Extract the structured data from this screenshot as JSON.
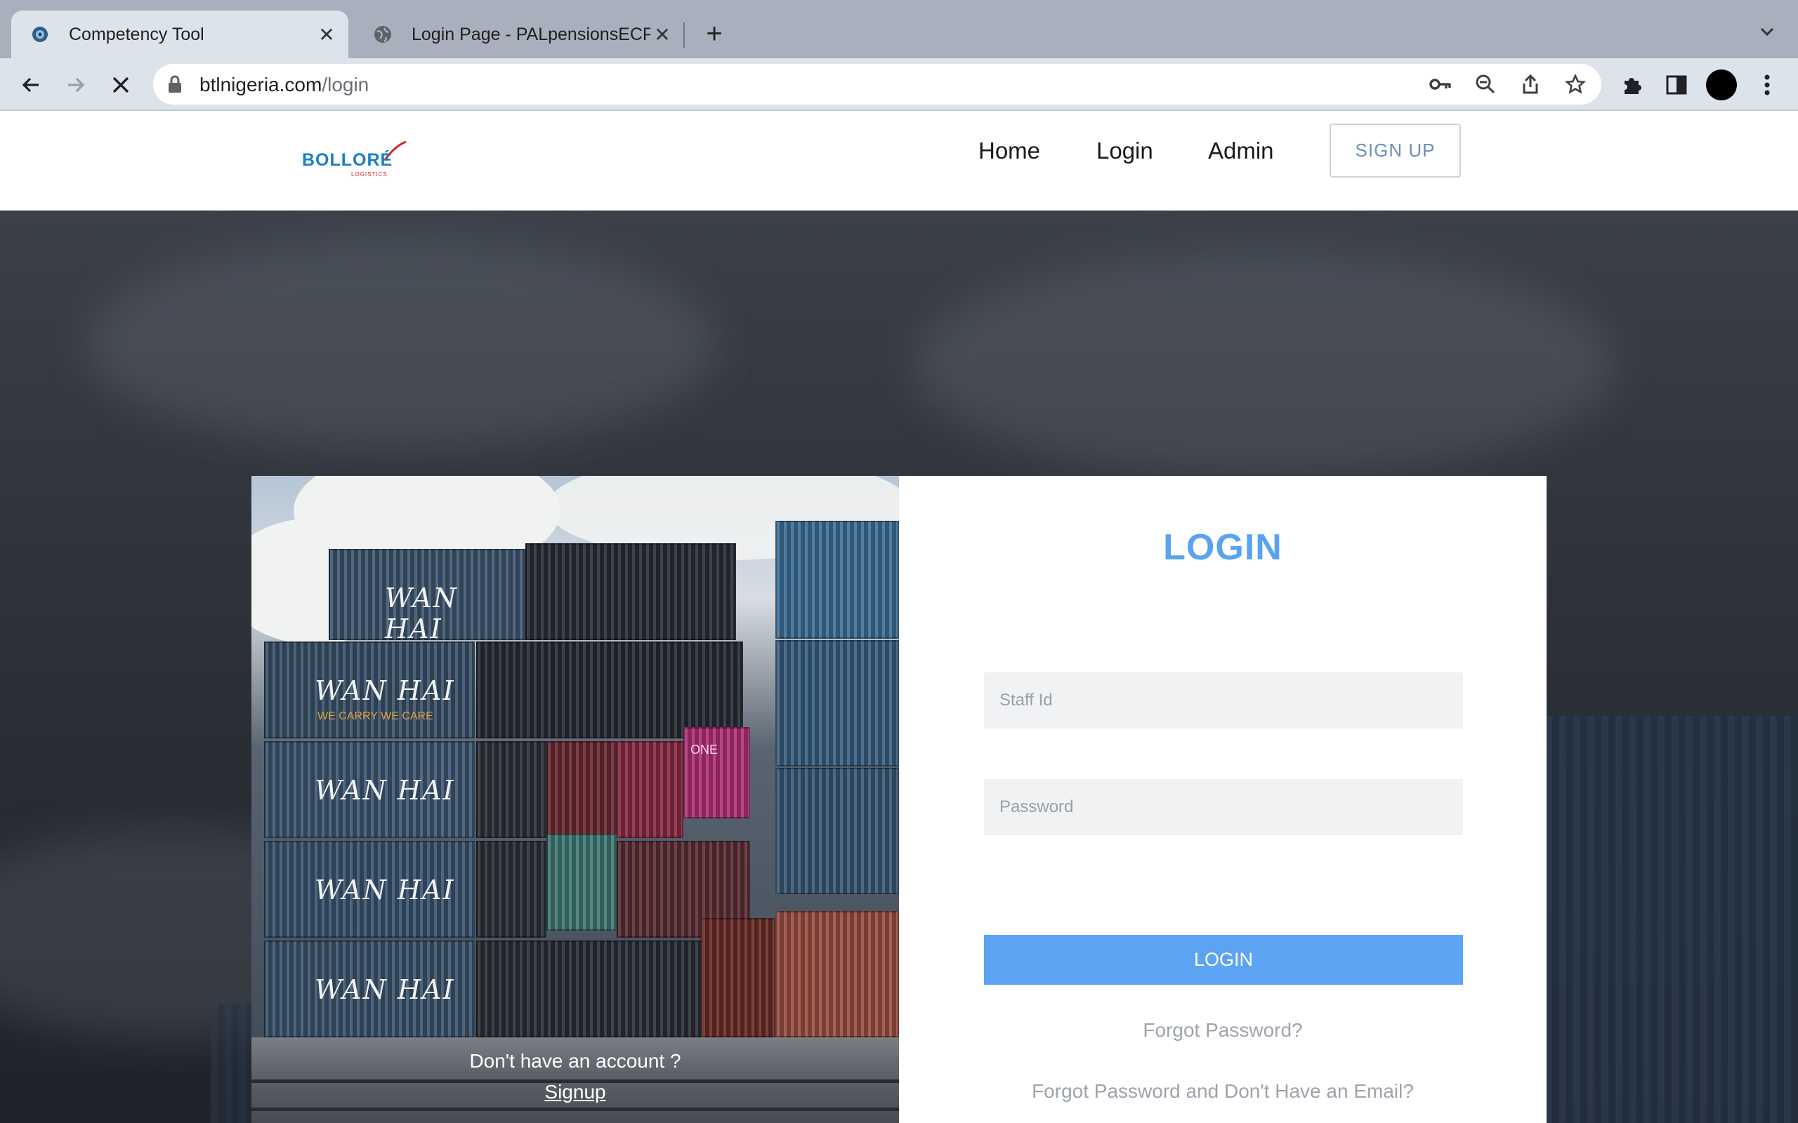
{
  "browser": {
    "tabs": [
      {
        "title": "Competency Tool",
        "active": true,
        "icon": "competency-favicon"
      },
      {
        "title": "Login Page - PALpensionsECP",
        "active": false,
        "icon": "globe-icon"
      }
    ],
    "url_host": "btlnigeria.com",
    "url_path": "/login"
  },
  "site": {
    "logo_text": "BOLLORÉ",
    "logo_sub": "LOGISTICS",
    "nav": {
      "home": "Home",
      "login": "Login",
      "admin": "Admin"
    },
    "signup_label": "SIGN UP",
    "brand_color": "#1b7ec2",
    "accent_color": "#5da3f4"
  },
  "photo_panel": {
    "container_mark": "WAN HAI",
    "container_mark_one": "ONE",
    "container_mark_tagline": "WE CARRY WE CARE",
    "question": "Don't have an account ?",
    "signup_link": "Signup"
  },
  "login_form": {
    "heading": "LOGIN",
    "staff_id_placeholder": "Staff Id",
    "password_placeholder": "Password",
    "submit_label": "LOGIN",
    "forgot_password": "Forgot Password?",
    "forgot_no_email": "Forgot Password and Don't Have an Email?"
  }
}
